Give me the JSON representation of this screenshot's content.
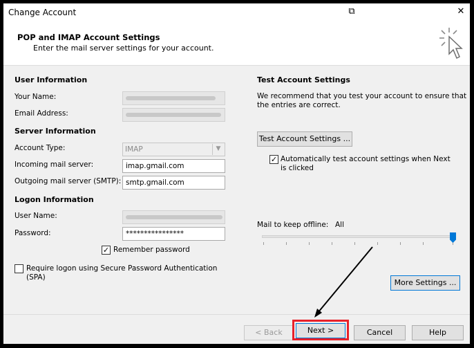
{
  "window": {
    "title": "Change Account",
    "restore_icon": "restore-icon",
    "close_icon": "close-icon",
    "close_glyph": "✕",
    "restore_glyph": "⧉"
  },
  "header": {
    "title": "POP and IMAP Account Settings",
    "subtitle": "Enter the mail server settings for your account.",
    "icon": "cursor-click-icon"
  },
  "left": {
    "user_info_heading": "User Information",
    "your_name_label": "Your Name:",
    "email_label": "Email Address:",
    "server_info_heading": "Server Information",
    "account_type_label": "Account Type:",
    "account_type_value": "IMAP",
    "incoming_label": "Incoming mail server:",
    "incoming_value": "imap.gmail.com",
    "outgoing_label": "Outgoing mail server (SMTP):",
    "outgoing_value": "smtp.gmail.com",
    "logon_heading": "Logon Information",
    "username_label": "User Name:",
    "password_label": "Password:",
    "password_value": "****************",
    "remember_password": "Remember password",
    "remember_checked": true,
    "spa_line1": "Require logon using Secure Password Authentication",
    "spa_line2": "(SPA)",
    "spa_checked": false
  },
  "right": {
    "test_heading": "Test Account Settings",
    "test_desc_line1": "We recommend that you test your account to ensure that",
    "test_desc_line2": "the entries are correct.",
    "test_button": "Test Account Settings ...",
    "auto_test_line1": "Automatically test account settings when Next",
    "auto_test_line2": "is clicked",
    "auto_test_checked": true,
    "offline_label": "Mail to keep offline:",
    "offline_value": "All",
    "offline_level": 1.0,
    "more_settings": "More Settings ..."
  },
  "footer": {
    "back": "< Back",
    "next": "Next >",
    "cancel": "Cancel",
    "help": "Help"
  },
  "colors": {
    "accent": "#0078d7",
    "highlight": "#e8212a"
  }
}
